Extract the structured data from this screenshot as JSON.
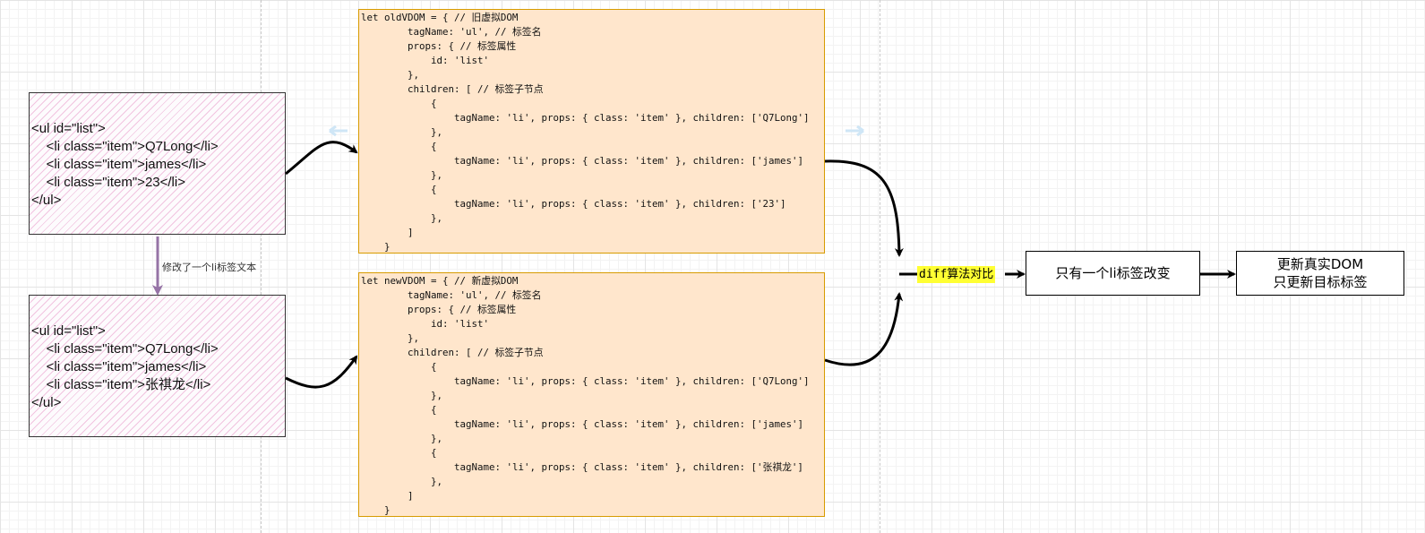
{
  "old_html": {
    "lines": [
      "<ul id=\"list\">",
      "    <li class=\"item\">Q7Long</li>",
      "    <li class=\"item\">james</li>",
      "    <li class=\"item\">23</li>",
      "</ul>"
    ]
  },
  "new_html": {
    "lines": [
      "<ul id=\"list\">",
      "    <li class=\"item\">Q7Long</li>",
      "    <li class=\"item\">james</li>",
      "    <li class=\"item\">张祺龙</li>",
      "</ul>"
    ]
  },
  "modify_label": "修改了一个li标签文本",
  "old_vdom": {
    "lines": [
      "let oldVDOM = { // 旧虚拟DOM",
      "        tagName: 'ul', // 标签名",
      "        props: { // 标签属性",
      "            id: 'list'",
      "        },",
      "        children: [ // 标签子节点",
      "            {",
      "                tagName: 'li', props: { class: 'item' }, children: ['Q7Long']",
      "            },",
      "            {",
      "                tagName: 'li', props: { class: 'item' }, children: ['james']",
      "            },",
      "            {",
      "                tagName: 'li', props: { class: 'item' }, children: ['23']",
      "            },",
      "        ]",
      "    }"
    ]
  },
  "new_vdom": {
    "lines": [
      "let newVDOM = { // 新虚拟DOM",
      "        tagName: 'ul', // 标签名",
      "        props: { // 标签属性",
      "            id: 'list'",
      "        },",
      "        children: [ // 标签子节点",
      "            {",
      "                tagName: 'li', props: { class: 'item' }, children: ['Q7Long']",
      "            },",
      "            {",
      "                tagName: 'li', props: { class: 'item' }, children: ['james']",
      "            },",
      "            {",
      "                tagName: 'li', props: { class: 'item' }, children: ['张祺龙']",
      "            },",
      "        ]",
      "    }"
    ]
  },
  "diff_label": "diff算法对比",
  "change_box": {
    "text": "只有一个li标签改变"
  },
  "update_box": {
    "line1": "更新真实DOM",
    "line2": "只更新目标标签"
  },
  "colors": {
    "code_fill": "#ffe6cc",
    "code_stroke": "#d79b00",
    "highlight": "#ffff33",
    "purple_arrow": "#9673a6",
    "hatch": "#e896c8"
  }
}
